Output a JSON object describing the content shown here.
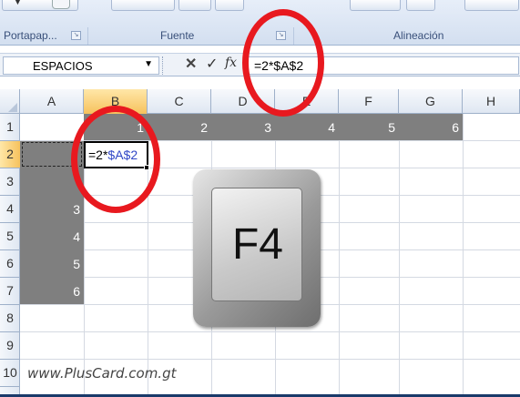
{
  "ribbon": {
    "groups": [
      {
        "label": "Portapap...",
        "launcher": "dialog-launcher-icon"
      },
      {
        "label": "Fuente",
        "launcher": "dialog-launcher-icon"
      },
      {
        "label": "Alineación",
        "launcher": ""
      }
    ]
  },
  "formula_bar": {
    "name_box": "ESPACIOS",
    "cancel_symbol": "✕",
    "enter_symbol": "✓",
    "fx_symbol": "fx",
    "formula": "=2*$A$2"
  },
  "grid": {
    "columns": [
      "A",
      "B",
      "C",
      "D",
      "E",
      "F",
      "G",
      "H"
    ],
    "rows": [
      "1",
      "2",
      "3",
      "4",
      "5",
      "6",
      "7",
      "8",
      "9",
      "10"
    ],
    "row1_values": [
      "1",
      "2",
      "3",
      "4",
      "5",
      "6"
    ],
    "colA_values": [
      "3",
      "4",
      "5",
      "6"
    ],
    "active_cell": {
      "prefix": "=2*",
      "ref": "$A$2"
    }
  },
  "overlay": {
    "key_label": "F4",
    "watermark": "www.PlusCard.com.gt",
    "highlight_color": "#e8191f"
  }
}
